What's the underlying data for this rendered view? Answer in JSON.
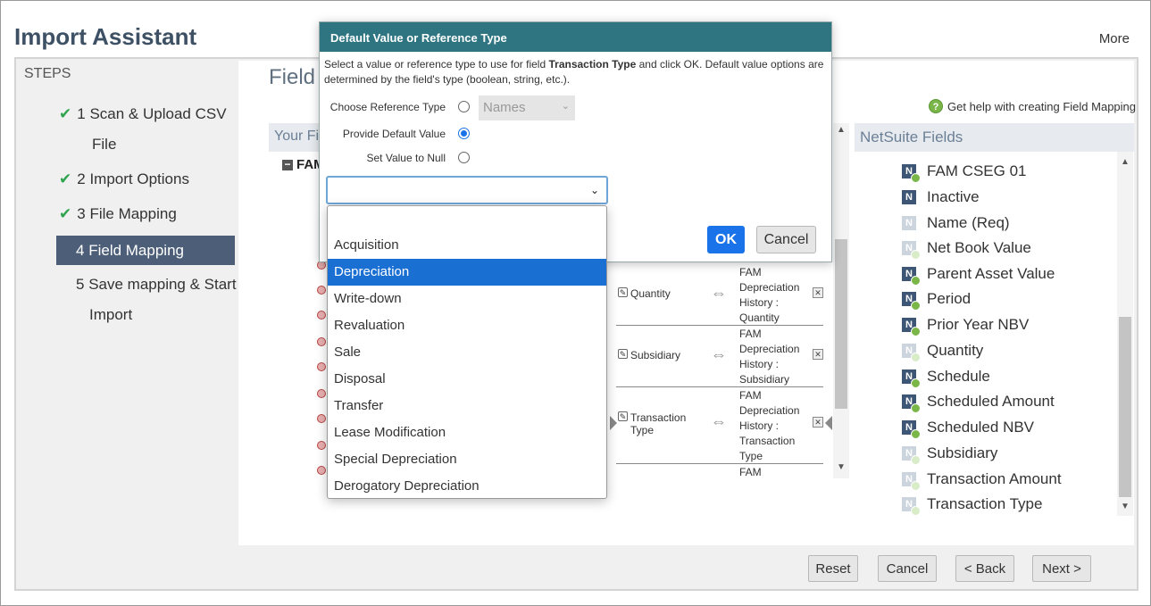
{
  "header": {
    "title": "Import Assistant",
    "more": "More"
  },
  "steps": {
    "title": "STEPS",
    "items": [
      {
        "num": "1",
        "label": "Scan & Upload CSV",
        "label2": "File",
        "done": true
      },
      {
        "num": "2",
        "label": "Import Options",
        "done": true
      },
      {
        "num": "3",
        "label": "File Mapping",
        "done": true
      },
      {
        "num": "4",
        "label": "Field Mapping",
        "active": true
      },
      {
        "num": "5",
        "label": "Save mapping & Start",
        "label2": "Import"
      }
    ]
  },
  "main": {
    "heading": "Field",
    "help_link": "Get help with creating Field Mapping",
    "your_fields_header": "Your Fi",
    "fam_label": "FAM",
    "mappings": [
      {
        "source": "Quantity",
        "target": [
          "FAM",
          "Depreciation",
          "History :",
          "Quantity"
        ]
      },
      {
        "source": "Subsidiary",
        "target": [
          "FAM",
          "Depreciation",
          "History :",
          "Subsidiary"
        ]
      },
      {
        "source": "Transaction Type",
        "source_lines": [
          "Transaction",
          "Type"
        ],
        "target": [
          "FAM",
          "Depreciation",
          "History :",
          "Transaction",
          "Type"
        ]
      },
      {
        "source": "",
        "target": [
          "FAM"
        ]
      }
    ],
    "netsuite_header": "NetSuite Fields",
    "netsuite_fields": [
      {
        "label": "FAM CSEG 01",
        "style": "dark",
        "badge": true
      },
      {
        "label": "Inactive",
        "style": "dark",
        "badge": false
      },
      {
        "label": "Name (Req)",
        "style": "light",
        "badge": false
      },
      {
        "label": "Net Book Value",
        "style": "light",
        "badge": true
      },
      {
        "label": "Parent Asset Value",
        "style": "dark",
        "badge": true
      },
      {
        "label": "Period",
        "style": "dark",
        "badge": true
      },
      {
        "label": "Prior Year NBV",
        "style": "dark",
        "badge": true
      },
      {
        "label": "Quantity",
        "style": "light",
        "badge": true
      },
      {
        "label": "Schedule",
        "style": "dark",
        "badge": true
      },
      {
        "label": "Scheduled Amount",
        "style": "dark",
        "badge": true
      },
      {
        "label": "Scheduled NBV",
        "style": "dark",
        "badge": true
      },
      {
        "label": "Subsidiary",
        "style": "light",
        "badge": true
      },
      {
        "label": "Transaction Amount",
        "style": "light",
        "badge": true
      },
      {
        "label": "Transaction Type",
        "style": "light",
        "badge": true
      }
    ]
  },
  "footer": {
    "reset": "Reset",
    "cancel": "Cancel",
    "back": "< Back",
    "next": "Next >"
  },
  "modal": {
    "title": "Default Value or Reference Type",
    "desc_pre": "Select a value or reference type to use for field ",
    "desc_field": "Transaction Type",
    "desc_post": " and click OK. Default value options are determined by the field's type (boolean, string, etc.).",
    "choose_ref_label": "Choose Reference Type",
    "provide_default_label": "Provide Default Value",
    "set_null_label": "Set Value to Null",
    "names_select": "Names",
    "selected_option": "Provide Default Value",
    "value_select_current": "",
    "ok": "OK",
    "cancel": "Cancel"
  },
  "dropdown": {
    "options": [
      "",
      "Acquisition",
      "Depreciation",
      "Write-down",
      "Revaluation",
      "Sale",
      "Disposal",
      "Transfer",
      "Lease Modification",
      "Special Depreciation",
      "Derogatory Depreciation"
    ],
    "highlighted": "Depreciation"
  },
  "colors": {
    "accent": "#1a73e8",
    "modal_header": "#2e7581",
    "active_step": "#4d5f78",
    "check": "#2ea44f"
  }
}
